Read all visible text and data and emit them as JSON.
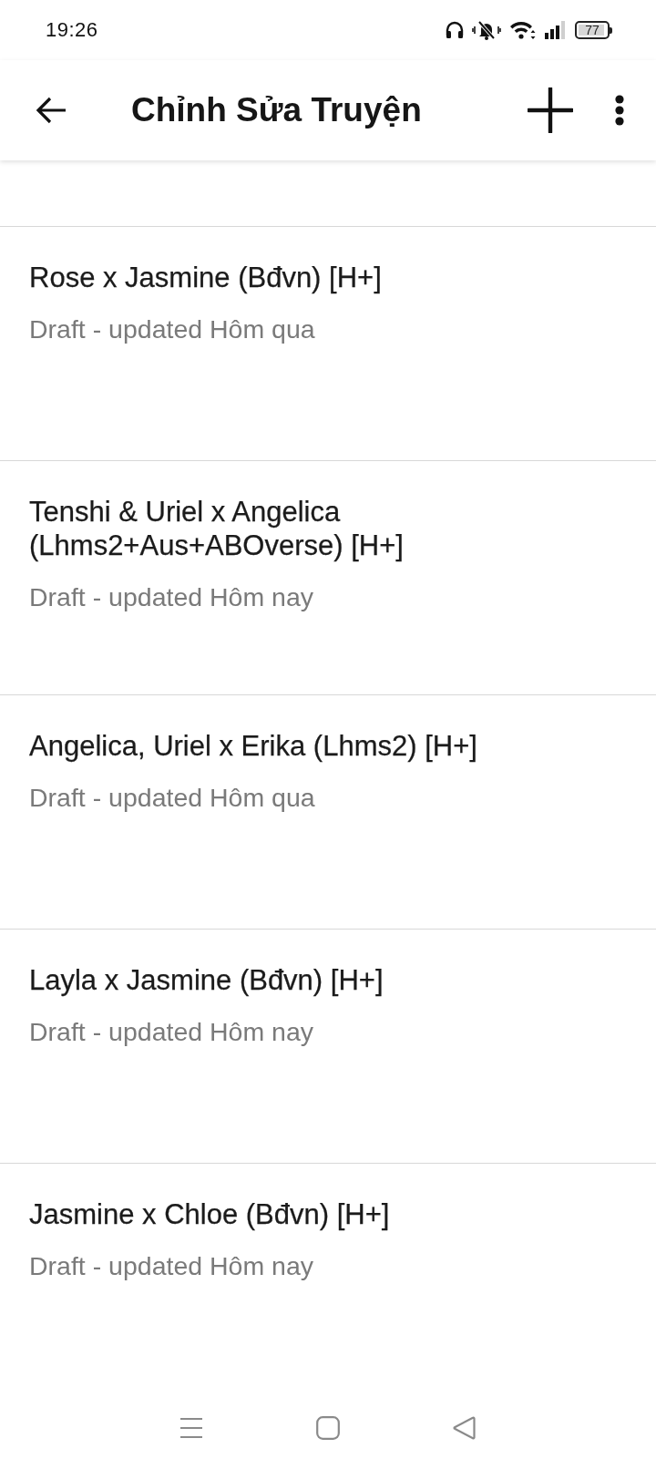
{
  "status_bar": {
    "time": "19:26",
    "battery": "77"
  },
  "app_bar": {
    "title": "Chỉnh Sửa Truyện"
  },
  "stories": [
    {
      "title": "Rose x Jasmine (Bđvn) [H+]",
      "subtitle": "Draft - updated Hôm qua"
    },
    {
      "title": "Tenshi & Uriel x Angelica (Lhms2+Aus+ABOverse) [H+]",
      "subtitle": "Draft - updated Hôm nay"
    },
    {
      "title": "Angelica, Uriel x Erika (Lhms2) [H+]",
      "subtitle": "Draft - updated Hôm qua"
    },
    {
      "title": "Layla x Jasmine (Bđvn) [H+]",
      "subtitle": "Draft - updated Hôm nay"
    },
    {
      "title": "Jasmine x Chloe (Bđvn) [H+]",
      "subtitle": "Draft - updated Hôm nay"
    }
  ]
}
